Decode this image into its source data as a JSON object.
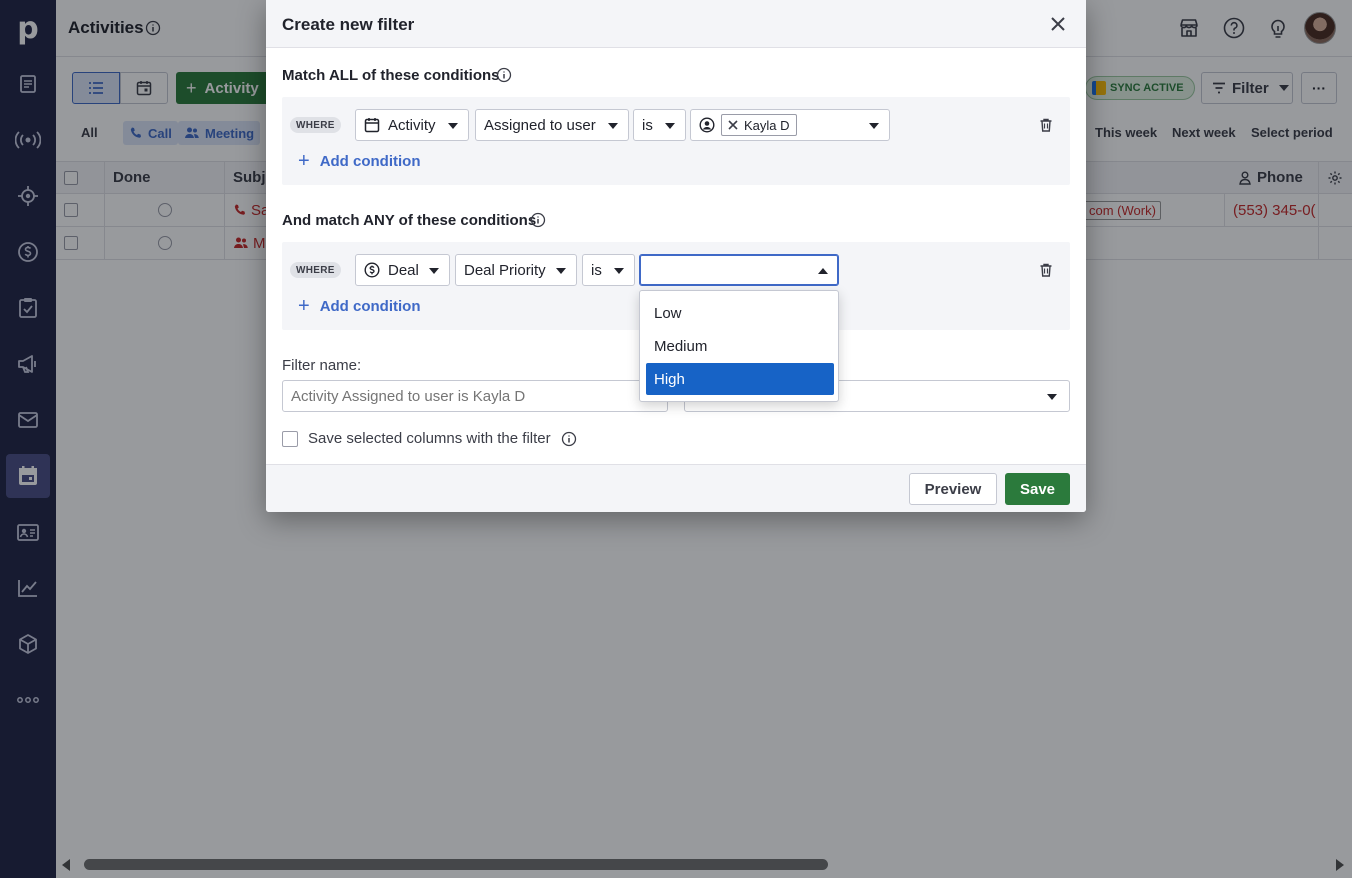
{
  "nav": {
    "logo": "p",
    "items": [
      "leads-icon",
      "deals-icon",
      "projects-icon",
      "products-icon",
      "tasks-icon",
      "campaigns-icon",
      "mail-icon",
      "activities-icon",
      "contacts-icon",
      "insights-icon",
      "marketplace-icon",
      "more-icon"
    ]
  },
  "page": {
    "title": "Activities",
    "add_activity_label": "Activity",
    "sync_label": "SYNC ACTIVE",
    "filter_label": "Filter",
    "more_label": "···"
  },
  "typebar": {
    "all": "All",
    "chips": [
      "Call",
      "Meeting"
    ],
    "periods": [
      "This week",
      "Next week",
      "Select period"
    ]
  },
  "table": {
    "columns": [
      "Done",
      "Subje",
      "Phone"
    ],
    "rows": [
      {
        "subject": "Sa",
        "email": "com (Work)",
        "phone": "(553) 345-0("
      },
      {
        "subject": "M",
        "email": "",
        "phone": ""
      }
    ]
  },
  "modal": {
    "title": "Create new filter",
    "all_section": "Match ALL of these conditions",
    "any_section": "And match ANY of these conditions",
    "where": "WHERE",
    "add_condition": "Add condition",
    "all_condition": {
      "entity": "Activity",
      "field": "Assigned to user",
      "operator": "is",
      "value_chip": "Kayla D"
    },
    "any_condition": {
      "entity": "Deal",
      "field": "Deal Priority",
      "operator": "is",
      "value": ""
    },
    "dropdown_options": [
      "Low",
      "Medium",
      "High"
    ],
    "dropdown_selected": "High",
    "filter_name_label": "Filter name:",
    "filter_name_value": "Activity Assigned to user is Kayla D",
    "save_columns_label": "Save selected columns with the filter",
    "preview_label": "Preview",
    "save_label": "Save"
  },
  "colors": {
    "nav_bg": "#212545",
    "primary_green": "#2b7a3c",
    "link_blue": "#3f69c7",
    "selected_blue": "#1763c6"
  }
}
